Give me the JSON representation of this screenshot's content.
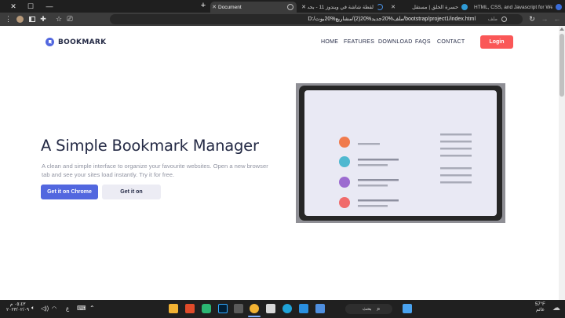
{
  "browser": {
    "tabs": [
      {
        "title": "Document",
        "favicon_color": "#8f8f8f",
        "active": true
      },
      {
        "title": "لقطة شاشة في ويندوز 11 - بحث G",
        "favicon_color": "#4a90e2",
        "active": false
      },
      {
        "title": "حسرة الخلق | مستقل",
        "favicon_color": "#2f9bd6",
        "active": false
      },
      {
        "title": "HTML, CSS, and Javascript for Web",
        "favicon_color": "#3a6cd8",
        "active": false
      }
    ],
    "window_controls": {
      "minimize": "—",
      "maximize": "☐",
      "close": "✕"
    },
    "new_tab": "+",
    "url": "D:/ملف%20جديد%20(2)/مشاريع%20بوت/bootstrap/project1/index.html",
    "file_label": "ملف",
    "icons": [
      "menu-dots-icon",
      "profile-icon",
      "sidebar-icon",
      "extensions-icon",
      "bookmark-star-icon",
      "cast-icon",
      "reload-icon",
      "back-icon",
      "forward-icon"
    ]
  },
  "site": {
    "brand": "BOOKMARK",
    "brand_color": "#5267df",
    "nav": [
      "HOME",
      "FEATURES",
      "DOWNLOAD",
      "FAQS",
      "CONTACT"
    ],
    "login": "Login",
    "login_color": "#fa5757",
    "hero": {
      "title": "A Simple Bookmark Manager",
      "description": "A clean and simple interface to organize your favourite websites. Open a new browser tab and see your sites load instantly. Try it for free.",
      "primary_button": "Get it on Chrome",
      "secondary_button": "Get it on"
    },
    "illustration": {
      "dots": [
        "#f07b4d",
        "#4fb8d0",
        "#9c6bd0",
        "#f06b6b"
      ],
      "line_color": "#a9abb8"
    }
  },
  "taskbar": {
    "search_label": "بحث",
    "time": "٠٥:٤٣ م",
    "date": "٢٠٢٣/٠٢/٠٩",
    "weather_temp": "57°F",
    "weather_label": "غائم",
    "lang": "ع",
    "apps": [
      {
        "name": "file-explorer-icon",
        "color": "#f2b233"
      },
      {
        "name": "office-icon",
        "color": "#e04b2a"
      },
      {
        "name": "figma-icon",
        "color": "#2bb673"
      },
      {
        "name": "photoshop-icon",
        "color": "#001e36"
      },
      {
        "name": "terminal-icon",
        "color": "#5a5a5a"
      },
      {
        "name": "chrome-icon",
        "color": "#f2b233"
      },
      {
        "name": "notepad-icon",
        "color": "#d8d8d8"
      },
      {
        "name": "edge-icon",
        "color": "#1fa3d9"
      },
      {
        "name": "store-icon",
        "color": "#4f8fe0"
      },
      {
        "name": "vscode-icon",
        "color": "#2a8fe0"
      },
      {
        "name": "start-icon",
        "color": "#4aa3f0"
      }
    ]
  }
}
